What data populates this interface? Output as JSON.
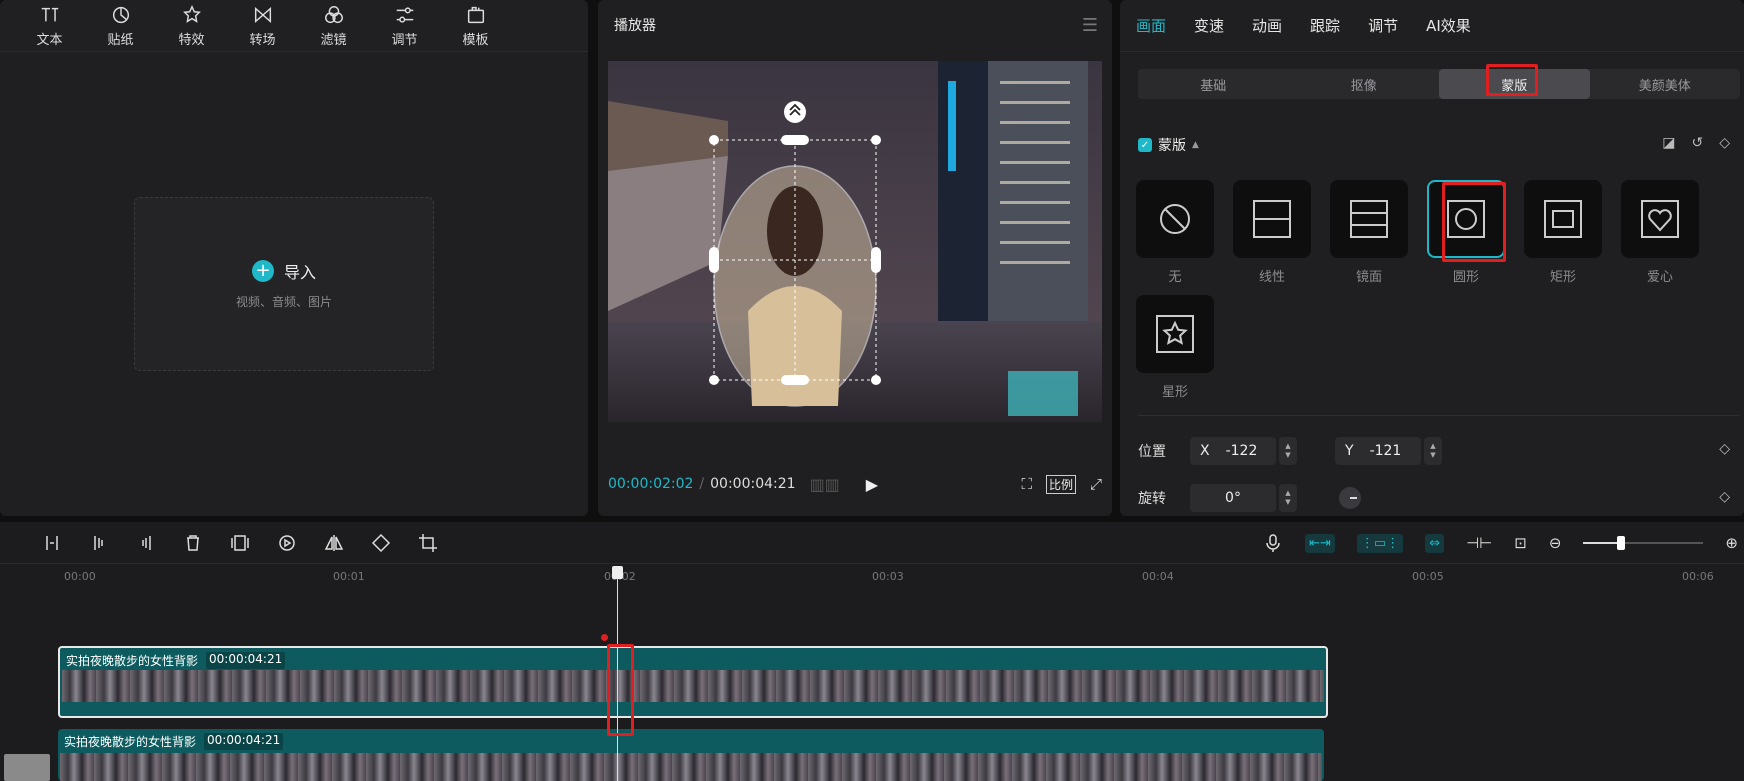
{
  "toolbar": {
    "tabs": [
      {
        "label": "文本",
        "icon": "text-icon"
      },
      {
        "label": "贴纸",
        "icon": "sticker-icon"
      },
      {
        "label": "特效",
        "icon": "effects-icon"
      },
      {
        "label": "转场",
        "icon": "transition-icon"
      },
      {
        "label": "滤镜",
        "icon": "filter-icon"
      },
      {
        "label": "调节",
        "icon": "adjust-icon"
      },
      {
        "label": "模板",
        "icon": "template-icon"
      }
    ]
  },
  "media": {
    "import_label": "导入",
    "import_sub": "视频、音频、图片"
  },
  "player": {
    "title": "播放器",
    "current_time": "00:00:02:02",
    "duration": "00:00:04:21",
    "ratio_label": "比例"
  },
  "props": {
    "tabs": [
      "画面",
      "变速",
      "动画",
      "跟踪",
      "调节",
      "AI效果"
    ],
    "active_tab": "画面",
    "sub_tabs": [
      "基础",
      "抠像",
      "蒙版",
      "美颜美体"
    ],
    "active_sub_tab": "蒙版",
    "mask_section_label": "蒙版",
    "masks": [
      {
        "label": "无",
        "icon": "none-icon"
      },
      {
        "label": "线性",
        "icon": "linear-icon"
      },
      {
        "label": "镜面",
        "icon": "mirror-icon"
      },
      {
        "label": "圆形",
        "icon": "circle-icon",
        "selected": true
      },
      {
        "label": "矩形",
        "icon": "rectangle-icon"
      },
      {
        "label": "爱心",
        "icon": "heart-icon"
      },
      {
        "label": "星形",
        "icon": "star-icon"
      }
    ],
    "position_label": "位置",
    "pos_x_label": "X",
    "pos_x": "-122",
    "pos_y_label": "Y",
    "pos_y": "-121",
    "rotation_label": "旋转",
    "rotation": "0°"
  },
  "timeline": {
    "ruler": [
      "00:00",
      "00:01",
      "00:02",
      "00:03",
      "00:04",
      "00:05",
      "00:06"
    ],
    "tracks": [
      {
        "name": "实拍夜晚散步的女性背影",
        "duration": "00:00:04:21"
      },
      {
        "name": "实拍夜晚散步的女性背影",
        "duration": "00:00:04:21"
      }
    ]
  },
  "colors": {
    "accent": "#1fb8c8",
    "highlight": "#e02020",
    "clip": "#0d5b5e"
  }
}
